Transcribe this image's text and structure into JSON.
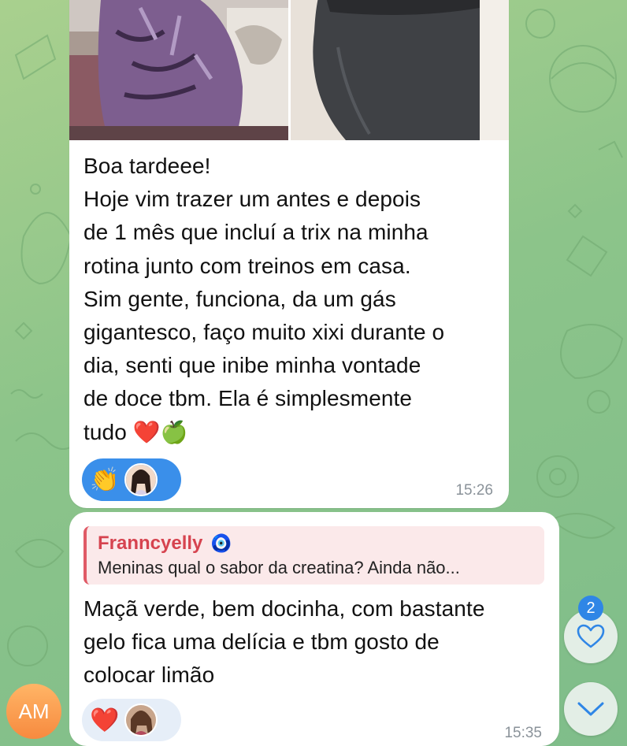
{
  "message1": {
    "text": "Boa tardeee!\nHoje vim trazer um antes e depois\nde 1 mês que incluí a trix na minha\nrotina junto com treinos em casa.\nSim gente, funciona, da um gás\ngigantesco, faço muito xixi durante o\ndia, senti que inibe minha vontade\nde doce tbm. Ela é simplesmente\ntudo ❤️🍏",
    "reaction_emoji": "👏",
    "time": "15:26"
  },
  "message2": {
    "reply_author": "Franncyelly",
    "reply_author_emoji": "🧿",
    "reply_text": "Meninas qual o sabor da creatina? Ainda não...",
    "text": "Maçã verde, bem docinha, com bastante\ngelo fica uma delícia e tbm gosto de\ncolocar limão",
    "reaction_emoji": "❤️",
    "time": "15:35"
  },
  "sender_avatar": {
    "initials": "AM"
  },
  "mentions_badge": {
    "count": "2"
  },
  "colors": {
    "accent": "#2f86e6",
    "reaction_active": "#3a8fea",
    "reply_name": "#d6434f",
    "avatar": "#f78a3f"
  }
}
